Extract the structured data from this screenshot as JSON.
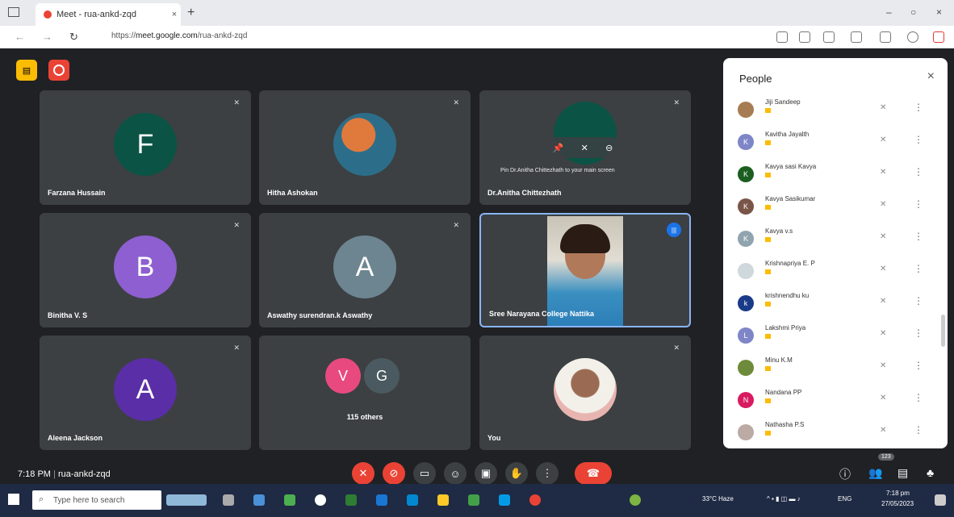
{
  "browser": {
    "tab_title": "Meet - rua-ankd-zqd",
    "tab_close": "×",
    "new_tab": "+",
    "url_prefix": "https://",
    "url_host": "meet.google.com",
    "url_path": "/rua-ankd-zqd",
    "window_min": "–",
    "window_max": "○",
    "window_close": "×"
  },
  "tiles": [
    {
      "name": "Farzana Hussain",
      "initial": "F",
      "color": "#0b5345"
    },
    {
      "name": "Hitha Ashokan",
      "initial": "",
      "color": "#3c4043"
    },
    {
      "name": "Dr.Anitha Chittezhath",
      "initial": "",
      "color": "#0b5345",
      "pin_text": "Pin Dr.Anitha Chittezhath to your main screen"
    },
    {
      "name": "Binitha V. S",
      "initial": "B",
      "color": "#8e5fd0"
    },
    {
      "name": "Aswathy surendran.k Aswathy",
      "initial": "A",
      "color": "#6d8590"
    },
    {
      "name": "Sree Narayana College Nattika",
      "initial": "",
      "color": "#3c4043"
    },
    {
      "name": "Aleena Jackson",
      "initial": "A",
      "color": "#5a2ea6"
    },
    {
      "name": "115 others",
      "initial": "",
      "color": "#3c4043"
    },
    {
      "name": "You",
      "initial": "",
      "color": "#3c4043"
    }
  ],
  "others": {
    "v": "V",
    "g": "G",
    "v_color": "#e84a7f",
    "g_color": "#4a5a60"
  },
  "bottom": {
    "time": "7:18 PM",
    "separator": "|",
    "meeting_code": "rua-ankd-zqd",
    "participant_count": "123"
  },
  "people": {
    "title": "People",
    "close": "×",
    "members": [
      {
        "name": "Jiji Sandeep",
        "initial": "",
        "color": "#a67c52"
      },
      {
        "name": "Kavitha Jayalth",
        "initial": "K",
        "color": "#7e86c8"
      },
      {
        "name": "Kavya sasi Kavya",
        "initial": "K",
        "color": "#1b5e20"
      },
      {
        "name": "Kavya Sasikumar",
        "initial": "K",
        "color": "#795548"
      },
      {
        "name": "Kavya v.s",
        "initial": "K",
        "color": "#90a4ae"
      },
      {
        "name": "Krishnapriya E. P",
        "initial": "",
        "color": "#cfd8dc"
      },
      {
        "name": "krishnendhu ku",
        "initial": "k",
        "color": "#1a3a8a"
      },
      {
        "name": "Lakshmi Priya",
        "initial": "L",
        "color": "#7e86c8"
      },
      {
        "name": "Minu K.M",
        "initial": "",
        "color": "#6d8b3a"
      },
      {
        "name": "Nandana PP",
        "initial": "N",
        "color": "#d81b60"
      },
      {
        "name": "Nathasha P.S",
        "initial": "",
        "color": "#bcaaa4"
      }
    ]
  },
  "taskbar": {
    "search_placeholder": "Type here to search",
    "weather": "33°C Haze",
    "lang": "ENG",
    "time": "7:18 pm",
    "date": "27/05/2023"
  }
}
